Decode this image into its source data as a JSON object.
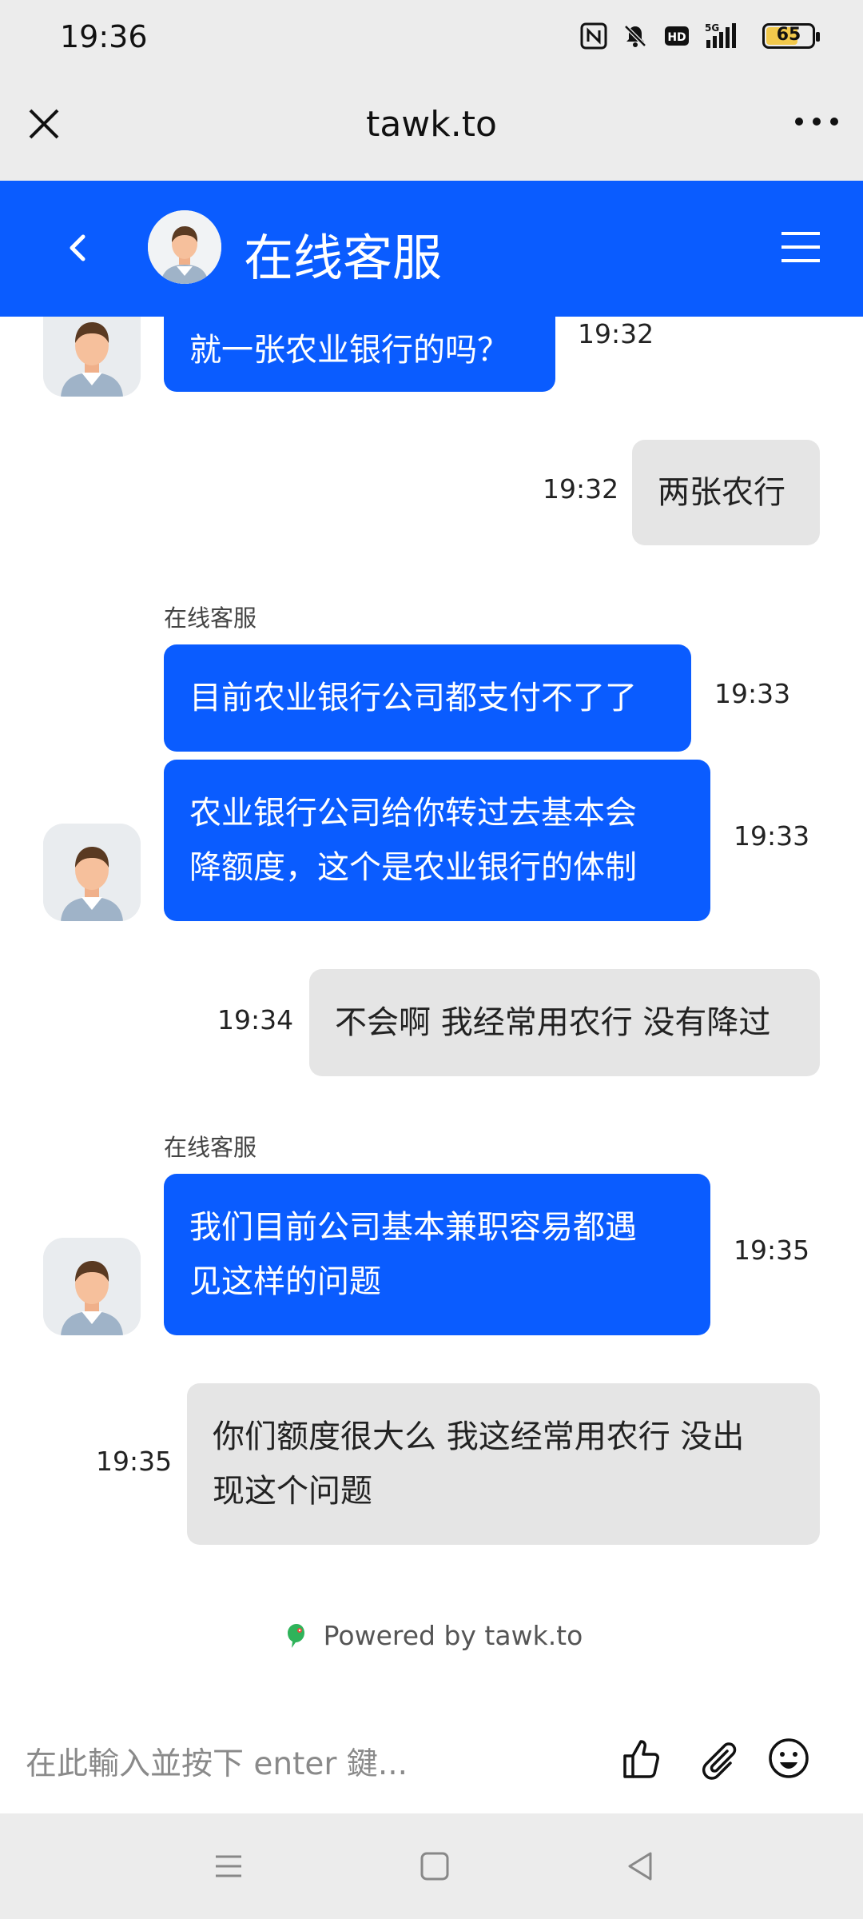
{
  "status_bar": {
    "time": "19:36",
    "icons": [
      "nfc-icon",
      "bell-muted-icon",
      "hd-icon",
      "signal-5g-icon",
      "battery-icon"
    ],
    "battery_level": "65"
  },
  "browser": {
    "title": "tawk.to",
    "close_icon": "close-icon",
    "more_icon": "more-icon"
  },
  "chat_header": {
    "title": "在线客服"
  },
  "messages": [
    {
      "sender": "agent",
      "text": "就一张农业银行的吗？",
      "time": "19:32"
    },
    {
      "sender": "visitor",
      "text": "两张农行",
      "time": "19:32"
    },
    {
      "sender": "agent",
      "name": "在线客服",
      "text": "目前农业银行公司都支付不了了",
      "time": "19:33"
    },
    {
      "sender": "agent",
      "text_lines": [
        "农业银行公司给你转过去基本会",
        "降额度，这个是农业银行的体制"
      ],
      "time": "19:33"
    },
    {
      "sender": "visitor",
      "text": "不会啊 我经常用农行 没有降过",
      "time": "19:34"
    },
    {
      "sender": "agent",
      "name": "在线客服",
      "text_lines": [
        "我们目前公司基本兼职容易都遇",
        "见这样的问题"
      ],
      "time": "19:35"
    },
    {
      "sender": "visitor",
      "text_lines": [
        "你们额度很大么 我这经常用农行 没出",
        "现这个问题"
      ],
      "time": "19:35"
    }
  ],
  "footer": {
    "powered_by": "Powered by tawk.to"
  },
  "input": {
    "placeholder": "在此輸入並按下 enter 鍵..."
  },
  "colors": {
    "accent": "#0a5cff",
    "visitor_bubble": "#e5e5e5",
    "chrome": "#ececec"
  }
}
